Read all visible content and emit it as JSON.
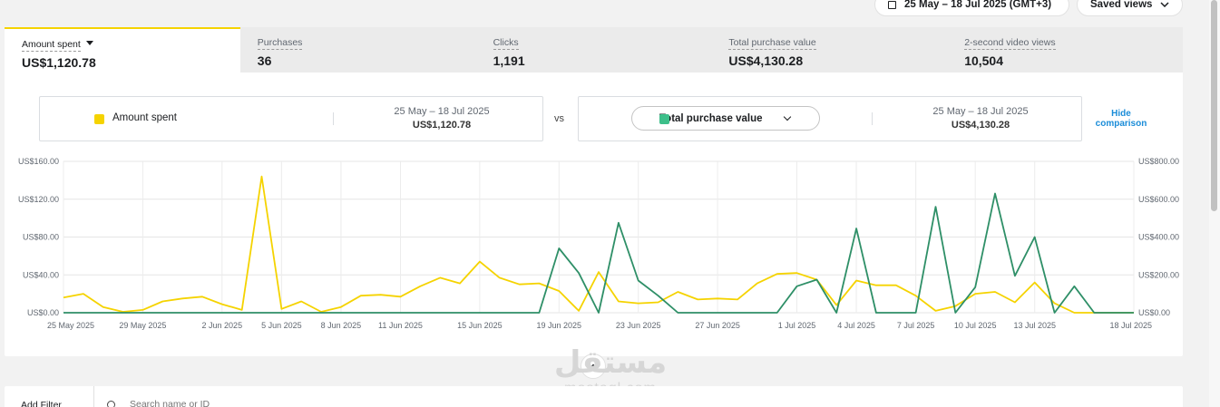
{
  "toolbar": {
    "date_range": "25 May – 18 Jul 2025 (GMT+3)",
    "saved_views": "Saved views"
  },
  "tabs": [
    {
      "label": "Amount spent",
      "value": "US$1,120.78"
    },
    {
      "label": "Purchases",
      "value": "36"
    },
    {
      "label": "Clicks",
      "value": "1,191"
    },
    {
      "label": "Total purchase value",
      "value": "US$4,130.28"
    },
    {
      "label": "2-second video views",
      "value": "10,504"
    }
  ],
  "comparison": {
    "left_metric": "Amount spent",
    "left_range": "25 May – 18 Jul 2025",
    "left_value": "US$1,120.78",
    "vs": "vs",
    "right_metric": "Total purchase value",
    "right_range": "25 May – 18 Jul 2025",
    "right_value": "US$4,130.28",
    "hide_label": "Hide comparison"
  },
  "colors": {
    "amount_spent": "#f5d300",
    "total_purchase_value": "#2e8f67",
    "tab_accent": "#f5d300",
    "link": "#1a8cd8"
  },
  "chart_data": {
    "type": "line",
    "x_labels": [
      "25 May 2025",
      "29 May 2025",
      "2 Jun 2025",
      "5 Jun 2025",
      "8 Jun 2025",
      "11 Jun 2025",
      "15 Jun 2025",
      "19 Jun 2025",
      "23 Jun 2025",
      "27 Jun 2025",
      "1 Jul 2025",
      "4 Jul 2025",
      "7 Jul 2025",
      "10 Jul 2025",
      "13 Jul 2025",
      "18 Jul 2025"
    ],
    "x_label_days": [
      0,
      4,
      8,
      11,
      14,
      17,
      21,
      25,
      29,
      33,
      37,
      40,
      43,
      46,
      49,
      54
    ],
    "y_left_ticks": [
      "US$0.00",
      "US$40.00",
      "US$80.00",
      "US$120.00",
      "US$160.00"
    ],
    "y_right_ticks": [
      "US$0.00",
      "US$200.00",
      "US$400.00",
      "US$600.00",
      "US$800.00"
    ],
    "y_left_range": [
      0,
      160
    ],
    "y_right_range": [
      0,
      800
    ],
    "grid": true,
    "series": [
      {
        "name": "Amount spent",
        "axis": "left",
        "values": [
          16,
          20,
          6,
          1,
          3,
          12,
          15,
          17,
          9,
          3,
          144,
          4,
          12,
          1,
          6,
          18,
          19,
          17,
          28,
          37,
          31,
          54,
          37,
          30,
          31,
          23,
          2,
          43,
          12,
          10,
          11,
          22,
          14,
          15,
          14,
          31,
          41,
          42,
          35,
          8,
          34,
          29,
          29,
          18,
          2,
          7,
          20,
          22,
          11,
          32,
          10,
          0,
          0,
          0,
          0
        ]
      },
      {
        "name": "Total purchase value",
        "axis": "right",
        "values": [
          0,
          0,
          0,
          0,
          0,
          0,
          0,
          0,
          0,
          0,
          0,
          0,
          0,
          0,
          0,
          0,
          0,
          0,
          0,
          0,
          0,
          0,
          0,
          0,
          0,
          340,
          210,
          0,
          475,
          170,
          90,
          0,
          0,
          0,
          0,
          0,
          0,
          140,
          175,
          0,
          445,
          0,
          0,
          0,
          560,
          0,
          135,
          630,
          195,
          400,
          0,
          140,
          0,
          0,
          0
        ]
      }
    ]
  },
  "collapse_icon": "chevron-up-icon",
  "watermark": {
    "arabic": "مستقل",
    "latin": "mostaql.com"
  },
  "filter": {
    "add_filter": "Add Filter",
    "search_placeholder": "Search name or ID"
  }
}
